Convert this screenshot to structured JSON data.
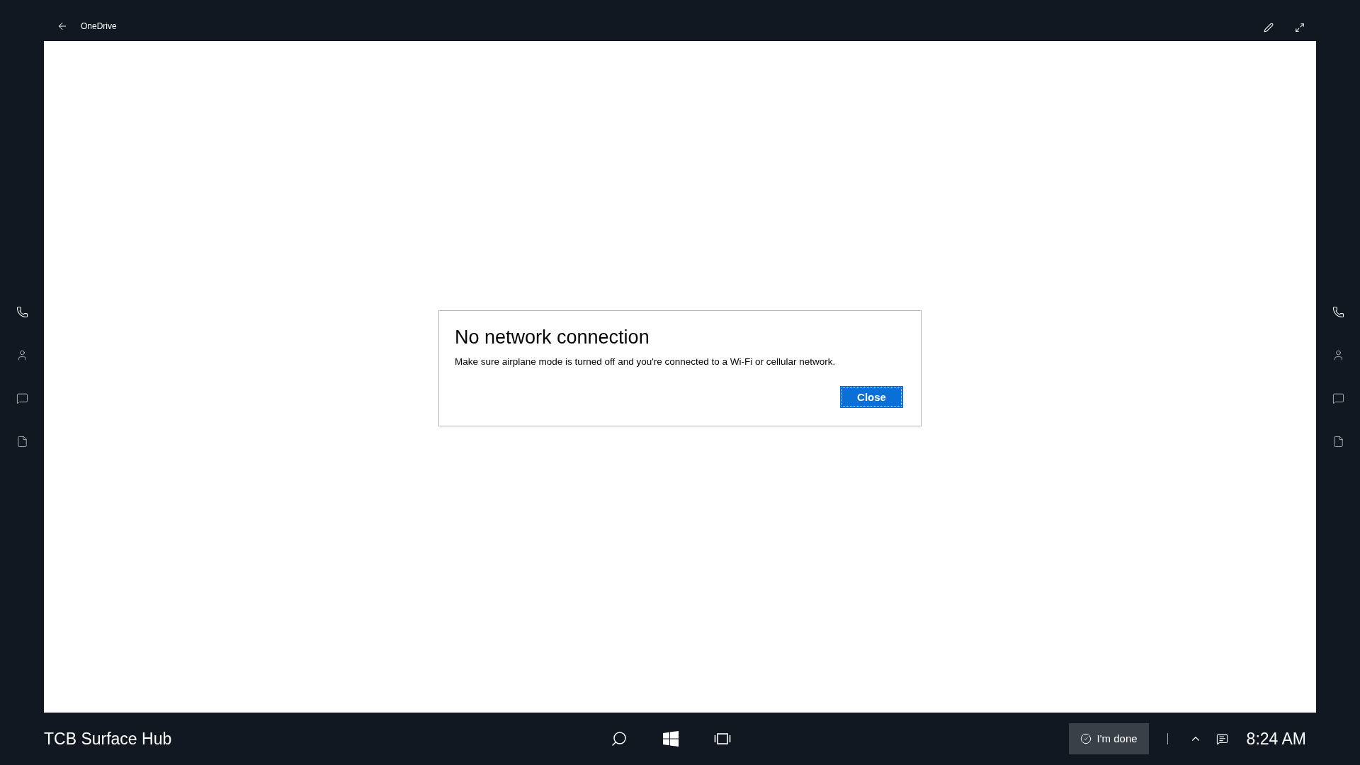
{
  "app_bar": {
    "title": "OneDrive"
  },
  "dialog": {
    "title": "No network connection",
    "message": "Make sure airplane mode is turned off and you're connected to a Wi-Fi or cellular network.",
    "button": {
      "label": "Close",
      "focused": true
    }
  },
  "taskbar": {
    "device_name": "TCB Surface Hub",
    "done_button": "I'm done",
    "time": "8:24 AM"
  }
}
